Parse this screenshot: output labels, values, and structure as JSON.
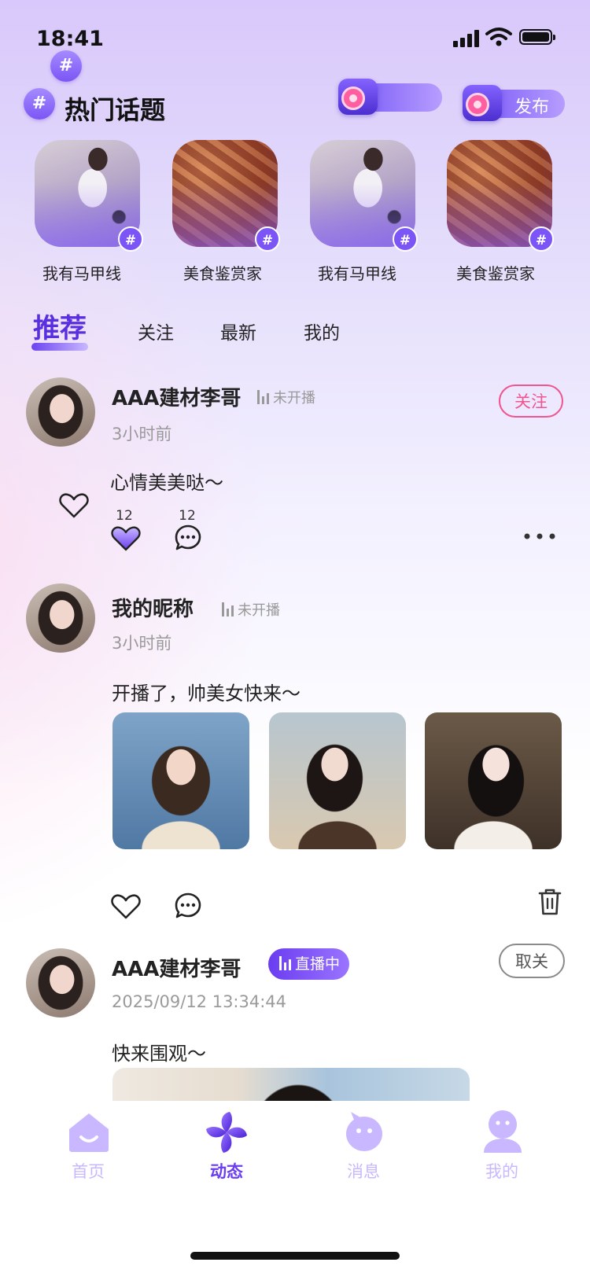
{
  "status_bar": {
    "time": "18:41"
  },
  "header": {
    "section_title": "热门话题",
    "hash_symbol": "#",
    "publish_label": "发布"
  },
  "topics": [
    {
      "label": "我有马甲线",
      "image": "gym"
    },
    {
      "label": "美食鉴赏家",
      "image": "food"
    },
    {
      "label": "我有马甲线",
      "image": "gym"
    },
    {
      "label": "美食鉴赏家",
      "image": "food"
    }
  ],
  "tabs": [
    {
      "label": "推荐",
      "active": true
    },
    {
      "label": "关注",
      "active": false
    },
    {
      "label": "最新",
      "active": false
    },
    {
      "label": "我的",
      "active": false
    }
  ],
  "posts": [
    {
      "username": "AAA建材李哥",
      "stream_status": "未开播",
      "time": "3小时前",
      "content": "心情美美哒～",
      "like_count": "12",
      "comment_count": "12",
      "action_label": "关注"
    },
    {
      "username": "我的昵称",
      "stream_status": "未开播",
      "time": "3小时前",
      "content": "开播了，帅美女快来～"
    },
    {
      "username": "AAA建材李哥",
      "stream_status": "直播中",
      "time": "2025/09/12 13:34:44",
      "content": "快来围观～",
      "action_label": "取关"
    }
  ],
  "bottom_nav": [
    {
      "label": "首页",
      "icon": "home-icon",
      "active": false
    },
    {
      "label": "动态",
      "icon": "pinwheel-icon",
      "active": true
    },
    {
      "label": "消息",
      "icon": "message-icon",
      "active": false
    },
    {
      "label": "我的",
      "icon": "profile-icon",
      "active": false
    }
  ],
  "colors": {
    "accent": "#6a3df0",
    "follow": "#f0558f",
    "nav_inactive": "#c9b8ff"
  }
}
